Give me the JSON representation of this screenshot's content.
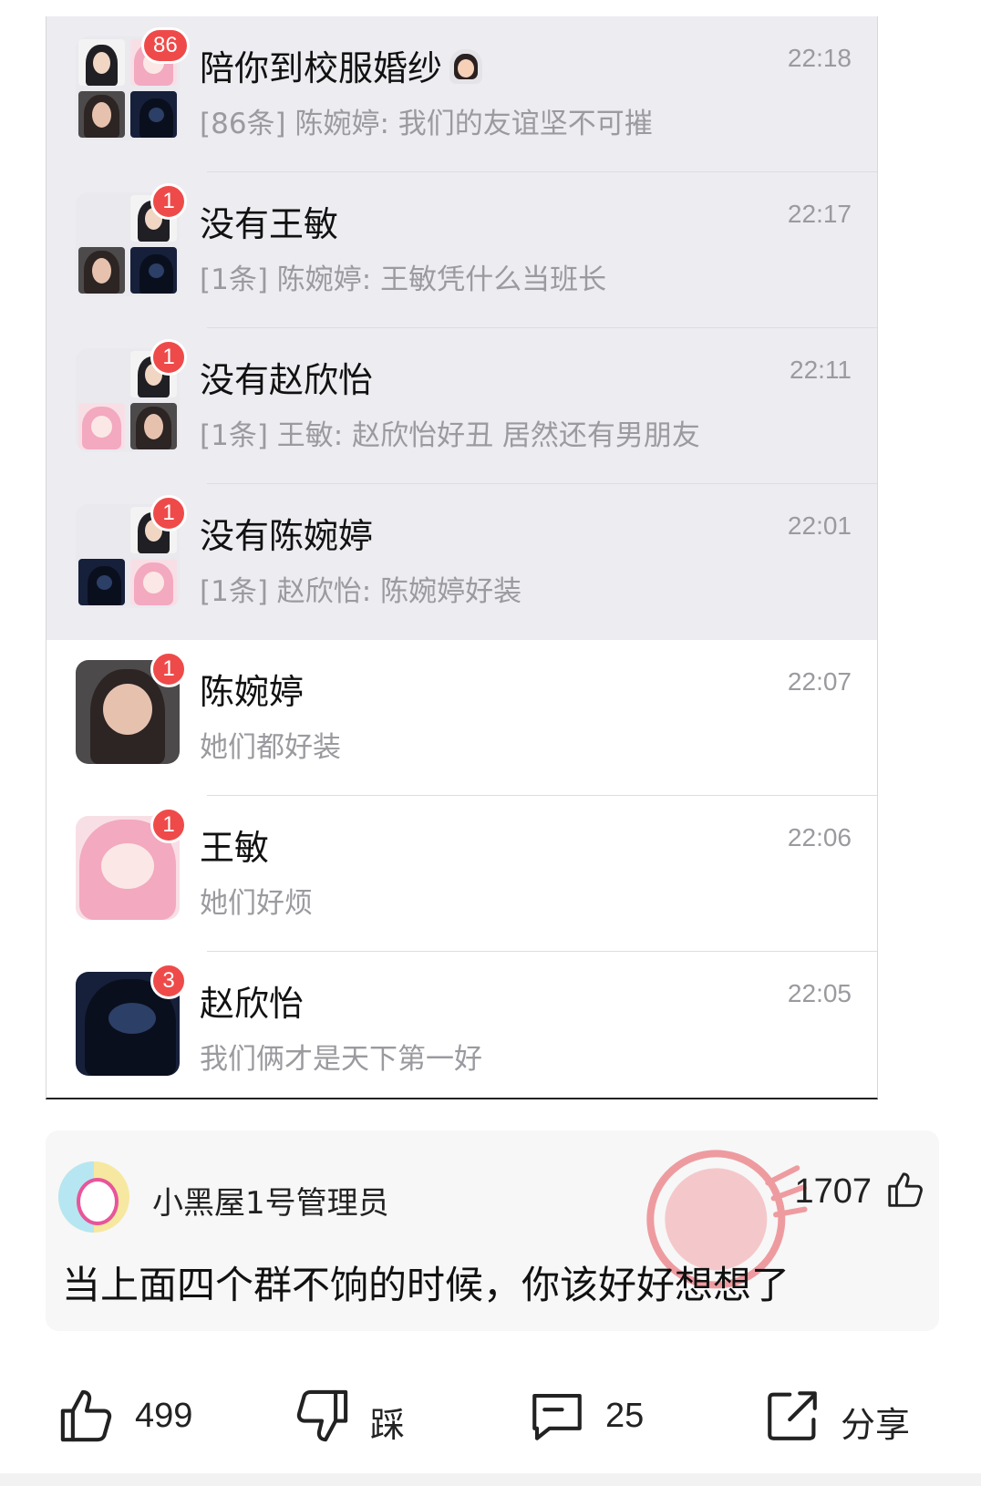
{
  "chats": [
    {
      "name": "陪你到校服婚纱",
      "time": "22:18",
      "preview": "[86条] 陈婉婷: 我们的友谊坚不可摧",
      "badge": "86",
      "pinned": true
    },
    {
      "name": "没有王敏",
      "time": "22:17",
      "preview": "[1条] 陈婉婷: 王敏凭什么当班长",
      "badge": "1",
      "pinned": true
    },
    {
      "name": "没有赵欣怡",
      "time": "22:11",
      "preview": "[1条] 王敏: 赵欣怡好丑 居然还有男朋友",
      "badge": "1",
      "pinned": true
    },
    {
      "name": "没有陈婉婷",
      "time": "22:01",
      "preview": "[1条] 赵欣怡: 陈婉婷好装",
      "badge": "1",
      "pinned": true
    },
    {
      "name": "陈婉婷",
      "time": "22:07",
      "preview": "她们都好装",
      "badge": "1",
      "pinned": false
    },
    {
      "name": "王敏",
      "time": "22:06",
      "preview": "她们好烦",
      "badge": "1",
      "pinned": false
    },
    {
      "name": "赵欣怡",
      "time": "22:05",
      "preview": "我们俩才是天下第一好",
      "badge": "3",
      "pinned": false
    }
  ],
  "comment": {
    "username": "小黑屋1号管理员",
    "likes": "1707",
    "text": "当上面四个群不饷的时候，你该好好想想了"
  },
  "actions": {
    "like_count": "499",
    "dislike_label": "踩",
    "comment_count": "25",
    "share_label": "分享"
  },
  "colors": {
    "badge": "#ef4a4a",
    "pinned_bg": "#ececf1",
    "time": "#9a9a9f"
  }
}
